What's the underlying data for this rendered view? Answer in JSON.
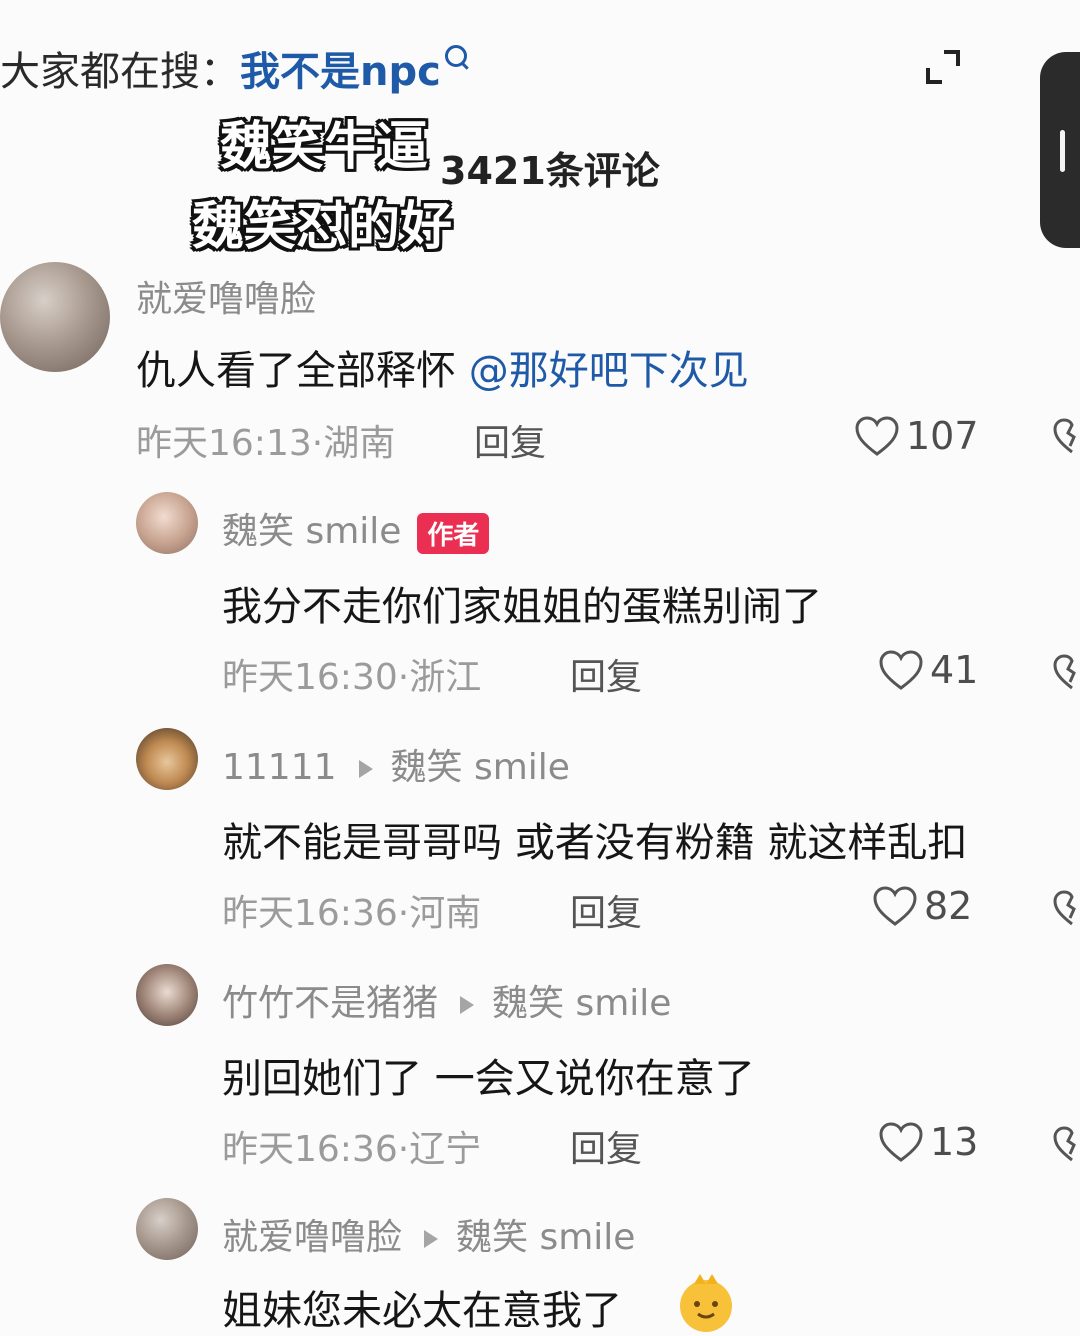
{
  "header": {
    "search_prefix": "大家都在搜：",
    "search_term": "我不是npc",
    "overlay_line_1": "魏笑牛逼",
    "overlay_line_2": "魏笑怼的好",
    "comment_count": "3421条评论"
  },
  "comments": [
    {
      "user": "就爱噜噜脸",
      "text": "仇人看了全部释怀 ",
      "mention": "@那好吧下次见",
      "time_location": "昨天16:13·湖南",
      "reply_label": "回复",
      "likes": "107"
    },
    {
      "user": "魏笑 smile",
      "badge": "作者",
      "text": "我分不走你们家姐姐的蛋糕别闹了",
      "time_location": "昨天16:30·浙江",
      "reply_label": "回复",
      "likes": "41"
    },
    {
      "user": "11111",
      "reply_to": "魏笑 smile",
      "text": "就不能是哥哥吗 或者没有粉籍 就这样乱扣",
      "time_location": "昨天16:36·河南",
      "reply_label": "回复",
      "likes": "82"
    },
    {
      "user": "竹竹不是猪猪",
      "reply_to": "魏笑 smile",
      "text": "别回她们了 一会又说你在意了",
      "time_location": "昨天16:36·辽宁",
      "reply_label": "回复",
      "likes": "13"
    },
    {
      "user": "就爱噜噜脸",
      "reply_to": "魏笑 smile",
      "text": "姐妹您未必太在意我了"
    }
  ],
  "icons": {
    "heart": "heart-outline-icon",
    "dislike": "broken-heart-icon",
    "collapse": "collapse-icon",
    "search": "search-icon"
  },
  "colors": {
    "link": "#1e5aa8",
    "badge": "#ea2f52",
    "meta": "#9b9b9b"
  }
}
